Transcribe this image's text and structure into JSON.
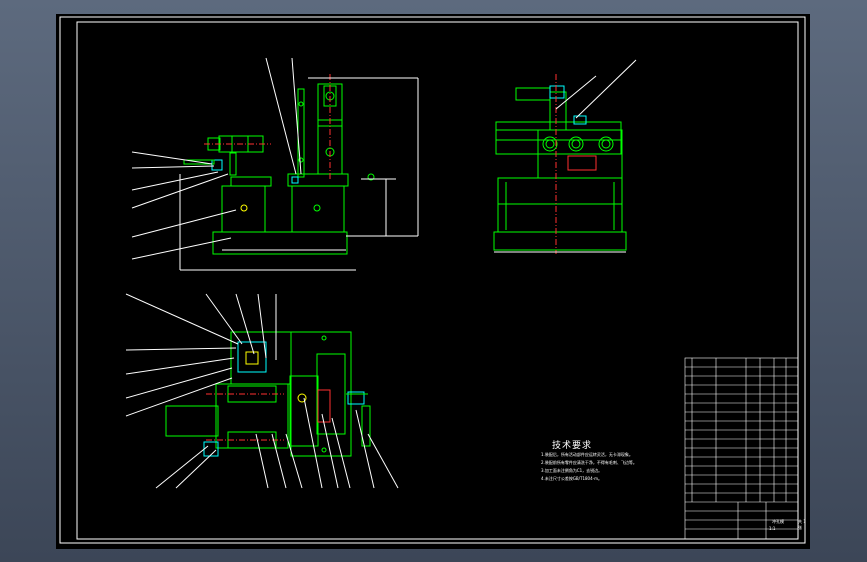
{
  "viewport": {
    "background": "#000000",
    "frame_color": "#ffffff"
  },
  "colors": {
    "part": "#00ff00",
    "dimension": "#ffffff",
    "centerline": "#ff3030",
    "hole": "#ffff00",
    "accent": "#00ffff",
    "app_background": "#4b5669"
  },
  "technical_requirements": {
    "title": "技术要求",
    "notes": [
      "1.装配后，所有活动部件应运转灵活，无卡滞现象。",
      "2.装配前所有零件应清洗干净，不得有毛刺、飞边等。",
      "3.加工面未注倒角为C1，去锐边。",
      "4.未注尺寸公差按GB/T1804-m。"
    ]
  },
  "title_block": {
    "drawing_name": "冲孔模",
    "scale": "1:1",
    "sheet": "共 1 张"
  },
  "views": [
    "front-view",
    "side-view",
    "top-view"
  ]
}
